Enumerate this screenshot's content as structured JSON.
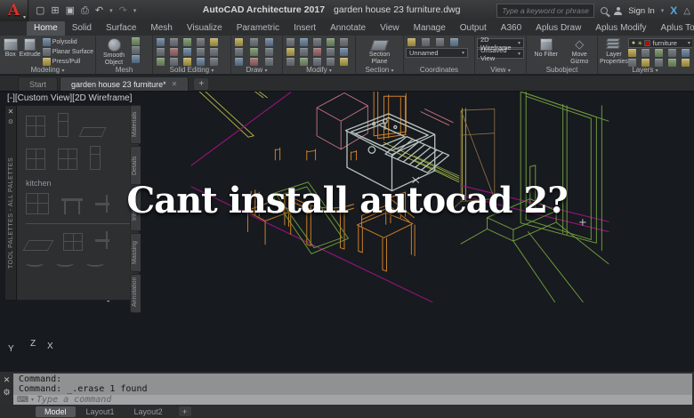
{
  "titlebar": {
    "app_initial": "A",
    "product": "AutoCAD Architecture 2017",
    "filename": "garden house 23 furniture.dwg",
    "search_placeholder": "Type a keyword or phrase",
    "sign_in": "Sign In"
  },
  "ribbon": {
    "tabs": [
      "Home",
      "Solid",
      "Surface",
      "Mesh",
      "Visualize",
      "Parametric",
      "Insert",
      "Annotate",
      "View",
      "Manage",
      "Output",
      "A360",
      "Aplus Draw",
      "Aplus Modify",
      "Aplus Tools"
    ],
    "active_tab": "Home",
    "panels": {
      "modeling": {
        "label": "Modeling",
        "box": "Box",
        "extrude": "Extrude",
        "polysolid": "Polysolid",
        "planar_surface": "Planar Surface",
        "press_pull": "Press/Pull"
      },
      "mesh": {
        "label": "Mesh",
        "smooth_object": "Smooth\nObject"
      },
      "solid_editing": {
        "label": "Solid Editing"
      },
      "draw": {
        "label": "Draw"
      },
      "modify": {
        "label": "Modify"
      },
      "section": {
        "label": "Section",
        "section_plane": "Section\nPlane"
      },
      "coordinates": {
        "label": "Coordinates",
        "ucs_value": "Unnamed"
      },
      "view": {
        "label": "View",
        "visual_style": "2D Wireframe",
        "named_view": "Unsaved View"
      },
      "subobject": {
        "label": "Subobject",
        "no_filter": "No Filter",
        "move_gizmo": "Move\nGizmo"
      },
      "layers": {
        "label": "Layers",
        "layer_properties": "Layer\nProperties",
        "current_layer": "furniture"
      }
    }
  },
  "file_tabs": {
    "start": "Start",
    "drawing": "garden house 23 furniture*",
    "new_tab": "+"
  },
  "viewport": {
    "controls": "[-][Custom View][2D Wireframe]"
  },
  "palette": {
    "title": "TOOL PALETTES - ALL PALETTES",
    "group_label": "kitchen",
    "tabs": [
      "Materials",
      "Details",
      "Interiors",
      "Massing",
      "Annotation"
    ]
  },
  "overlay": {
    "text": "Cant install autocad 2?"
  },
  "ucs": {
    "x": "X",
    "y": "Y",
    "z": "Z"
  },
  "command": {
    "line1": "Command:",
    "line2": "Command: _.erase 1 found",
    "input_placeholder": "Type a command"
  },
  "layout_tabs": {
    "model": "Model",
    "layout1": "Layout1",
    "layout2": "Layout2",
    "new": "+"
  },
  "icons": {
    "dropdown": "▾",
    "close": "✕",
    "undo": "↶",
    "redo": "↷",
    "new": "▢",
    "open": "⊞",
    "save": "▣",
    "plot": "⎙",
    "keyboard": "⌨",
    "gear": "⚙",
    "plus": "+",
    "bulb": "●",
    "sun": "☀",
    "lock": "◉",
    "diamond": "◇",
    "dots": "••"
  },
  "colors": {
    "wire_orange": "#cd8029",
    "wire_green": "#6e9a3b",
    "wire_magenta": "#8d1476",
    "wire_olive": "#b5b444",
    "wire_rose": "#c4737f",
    "wire_tan": "#8f7047",
    "sink_gray": "#b9c6c0",
    "layer_swatch": "#ae0f0f",
    "logo_red": "#d6322e"
  }
}
